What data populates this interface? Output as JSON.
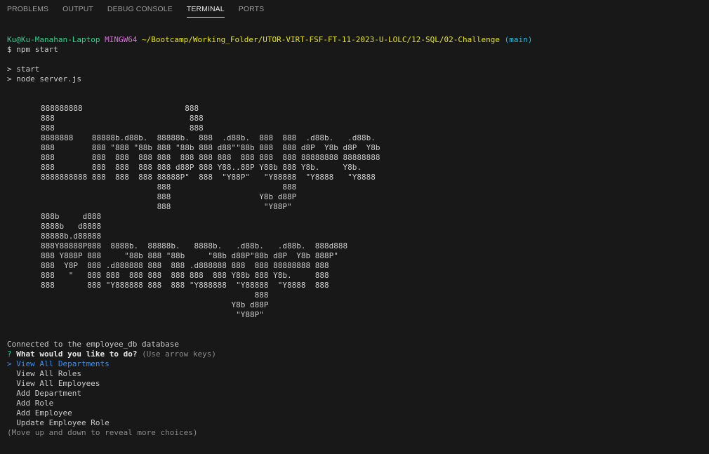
{
  "panel": {
    "tabs": [
      {
        "label": "PROBLEMS",
        "active": false
      },
      {
        "label": "OUTPUT",
        "active": false
      },
      {
        "label": "DEBUG CONSOLE",
        "active": false
      },
      {
        "label": "TERMINAL",
        "active": true
      },
      {
        "label": "PORTS",
        "active": false
      }
    ]
  },
  "terminal": {
    "prompt": {
      "user_host": "Ku@Ku-Manahan-Laptop",
      "shell": "MINGW64",
      "path": "~/Bootcamp/Working_Folder/UTOR-VIRT-FSF-FT-11-2023-U-LOLC/12-SQL/02-Challenge",
      "branch": "(main)"
    },
    "command": "$ npm start",
    "script_lines": [
      "> start",
      "> node server.js"
    ],
    "banner": [
      "888888888                      888",
      "888                             888",
      "888                             888",
      "8888888    88888b.d88b.  88888b.  888  .d88b.  888  888  .d88b.   .d88b.",
      "888        888 \"888 \"88b 888 \"88b 888 d88\"\"88b 888  888 d8P  Y8b d8P  Y8b",
      "888        888  888  888 888  888 888 888  888 888  888 88888888 88888888",
      "888        888  888  888 888 d88P 888 Y88..88P Y88b 888 Y8b.     Y8b.",
      "8888888888 888  888  888 88888P\"  888  \"Y88P\"   \"Y88888  \"Y8888   \"Y8888",
      "                         888                        888",
      "                         888                   Y8b d88P",
      "                         888                    \"Y88P\"",
      "888b     d888",
      "8888b   d8888",
      "88888b.d88888",
      "888Y88888P888  8888b.  88888b.   8888b.   .d88b.   .d88b.  888d888",
      "888 Y888P 888     \"88b 888 \"88b     \"88b d88P\"88b d8P  Y8b 888P\"",
      "888  Y8P  888 .d888888 888  888 .d888888 888  888 88888888 888",
      "888   \"   888 888  888 888  888 888  888 Y88b 888 Y8b.     888",
      "888       888 \"Y888888 888  888 \"Y888888  \"Y88888  \"Y8888  888",
      "                                              888",
      "                                         Y8b d88P",
      "                                          \"Y88P\""
    ],
    "connected": "Connected to the employee_db database",
    "question": {
      "mark": "?",
      "text": "What would you like to do?",
      "hint": "(Use arrow keys)"
    },
    "choices": [
      "View All Departments",
      "View All Roles",
      "View All Employees",
      "Add Department",
      "Add Role",
      "Add Employee",
      "Update Employee Role"
    ],
    "selected_index": 0,
    "pointer": ">",
    "footer": "(Move up and down to reveal more choices)"
  },
  "colors": {
    "background": "#181818",
    "user_host": "#23d18b",
    "shell": "#d670d6",
    "path": "#e5e510",
    "branch": "#29b8db",
    "selected_choice": "#3b8eea"
  }
}
